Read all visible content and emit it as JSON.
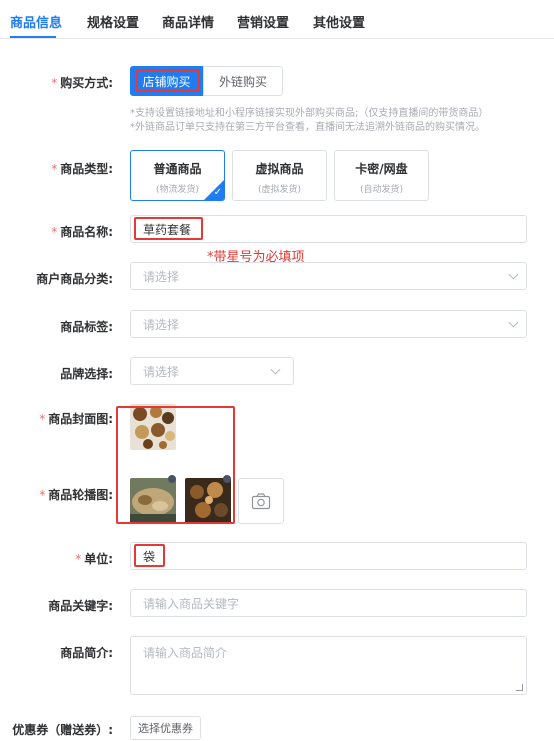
{
  "tabs": [
    "商品信息",
    "规格设置",
    "商品详情",
    "营销设置",
    "其他设置"
  ],
  "form": {
    "required_mark": "*",
    "purchase": {
      "label": "购买方式:",
      "options": [
        "店铺购买",
        "外链购买"
      ],
      "selected": "店铺购买",
      "hint1": "*支持设置链接地址和小程序链接实现外部购买商品;（仅支持直播间的带货商品）",
      "hint2": "*外链商品订单只支持在第三方平台查看，直播间无法追溯外链商品的购买情况。"
    },
    "product_type": {
      "label": "商品类型:",
      "cards": [
        {
          "title": "普通商品",
          "sub": "(物流发货)"
        },
        {
          "title": "虚拟商品",
          "sub": "(虚拟发货)"
        },
        {
          "title": "卡密/网盘",
          "sub": "(自动发货)"
        }
      ],
      "selected": "普通商品",
      "check": "✓"
    },
    "name": {
      "label": "商品名称:",
      "value": "草药套餐"
    },
    "annotation": "*带星号为必填项",
    "merchant_category": {
      "label": "商户商品分类:",
      "placeholder": "请选择"
    },
    "tags": {
      "label": "商品标签:",
      "placeholder": "请选择"
    },
    "brand": {
      "label": "品牌选择:",
      "placeholder": "请选择"
    },
    "cover": {
      "label": "商品封面图:"
    },
    "carousel": {
      "label": "商品轮播图:"
    },
    "unit": {
      "label": "单位:",
      "value": "袋"
    },
    "keywords": {
      "label": "商品关键字:",
      "placeholder": "请输入商品关键字"
    },
    "intro": {
      "label": "商品简介:",
      "placeholder": "请输入商品简介"
    },
    "coupon": {
      "label": "优惠券（赠送券）:",
      "button": "选择优惠券"
    }
  },
  "colors": {
    "accent": "#1f7cf2",
    "annotation_red": "#e53935",
    "required": "#f56c6c"
  },
  "icons": [
    "camera-icon",
    "chevron-down-icon",
    "check-icon",
    "resize-handle-icon"
  ]
}
